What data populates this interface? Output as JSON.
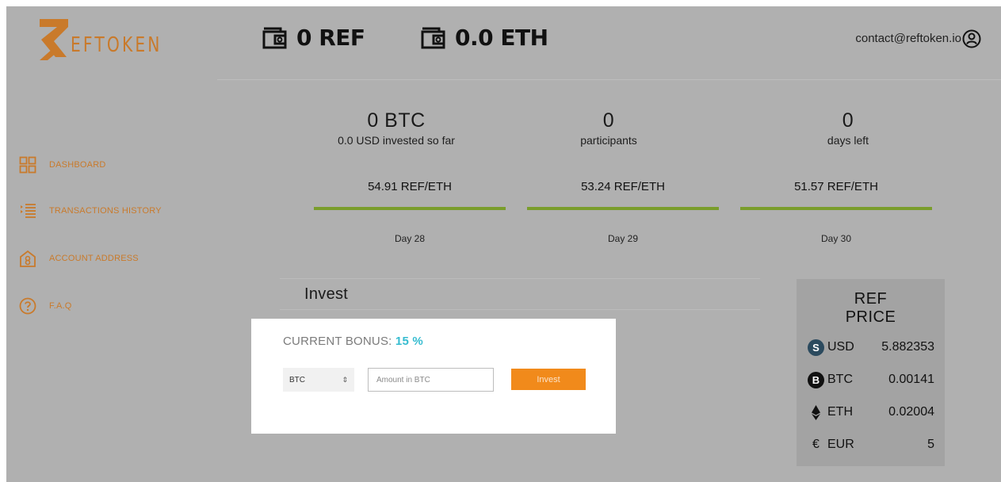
{
  "brand": {
    "name": "EFTOKEN",
    "accent": "#c97a2b"
  },
  "header": {
    "ref_balance": "0 REF",
    "eth_balance": "0.0 ETH",
    "contact": "contact@reftoken.io"
  },
  "sidebar": {
    "items": [
      {
        "label": "DASHBOARD",
        "icon": "grid-icon"
      },
      {
        "label": "TRANSACTIONS HISTORY",
        "icon": "list-icon"
      },
      {
        "label": "ACCOUNT ADDRESS",
        "icon": "house-icon"
      },
      {
        "label": "F.A.Q",
        "icon": "question-icon"
      }
    ]
  },
  "stats": [
    {
      "value": "0 BTC",
      "label": "0.0 USD invested so far"
    },
    {
      "value": "0",
      "label": "participants"
    },
    {
      "value": "0",
      "label": "days left"
    }
  ],
  "rates": [
    {
      "rate": "54.91 REF/ETH",
      "day": "Day 28"
    },
    {
      "rate": "53.24 REF/ETH",
      "day": "Day 29"
    },
    {
      "rate": "51.57 REF/ETH",
      "day": "Day 30"
    }
  ],
  "invest": {
    "title": "Invest",
    "bonus_label": "CURRENT BONUS:",
    "bonus_value": "15 %",
    "currency_selected": "BTC",
    "amount_placeholder": "Amount in BTC",
    "button_label": "Invest"
  },
  "price_panel": {
    "title_line1": "REF",
    "title_line2": "PRICE",
    "rows": [
      {
        "currency": "USD",
        "value": "5.882353",
        "symbol": "S"
      },
      {
        "currency": "BTC",
        "value": "0.00141",
        "symbol": "B"
      },
      {
        "currency": "ETH",
        "value": "0.02004",
        "symbol": ""
      },
      {
        "currency": "EUR",
        "value": "5",
        "symbol": "€"
      }
    ]
  },
  "colors": {
    "background": "#b0b0b0",
    "bar": "#7a9d2c",
    "invest_button": "#f18a1b",
    "bonus": "#36bcd0"
  }
}
